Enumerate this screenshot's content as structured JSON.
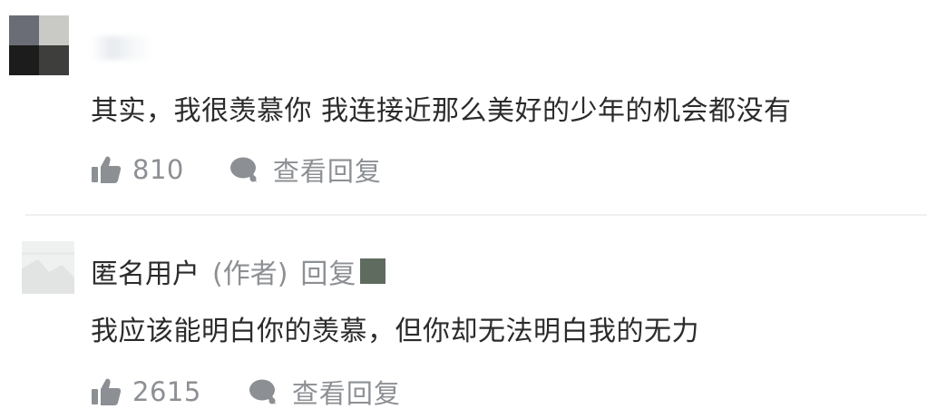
{
  "comments": [
    {
      "text": "其实，我很羡慕你 我连接近那么美好的少年的机会都没有",
      "likes": "810",
      "view_replies": "查看回复"
    },
    {
      "author": "匿名用户",
      "author_tag": "(作者)",
      "reply_label": "回复",
      "text": "我应该能明白你的羡慕，但你却无法明白我的无力",
      "likes": "2615",
      "view_replies": "查看回复"
    }
  ],
  "icons": {
    "like": "thumbs-up-icon",
    "reply": "speech-bubble-icon"
  },
  "colors": {
    "text": "#2b2b2b",
    "muted": "#8c8f93",
    "divider": "#eef0f2"
  }
}
